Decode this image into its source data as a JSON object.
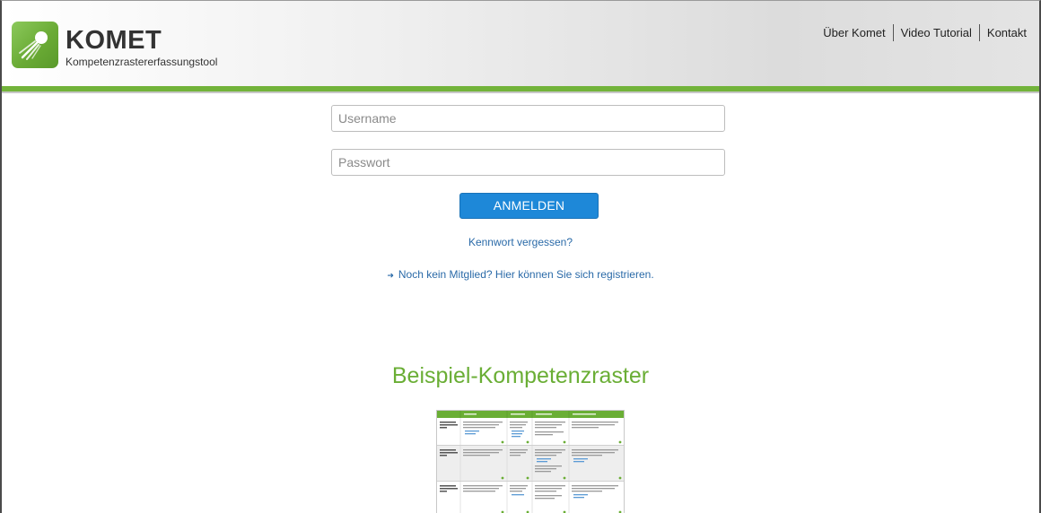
{
  "header": {
    "brand_title": "KOMET",
    "brand_subtitle": "Kompetenzrastererfassungstool",
    "logo_icon": "comet-icon",
    "nav": [
      {
        "label": "Über Komet"
      },
      {
        "label": "Video Tutorial"
      },
      {
        "label": "Kontakt"
      }
    ]
  },
  "login": {
    "username_placeholder": "Username",
    "password_placeholder": "Passwort",
    "submit_label": "ANMELDEN",
    "forgot_link": "Kennwort vergessen?",
    "register_link": "Noch kein Mitglied? Hier können Sie sich registrieren."
  },
  "example": {
    "title": "Beispiel-Kompetenzraster"
  },
  "colors": {
    "accent_green": "#72b33a",
    "button_blue": "#1e88d8",
    "link_blue": "#2a6aa8"
  }
}
